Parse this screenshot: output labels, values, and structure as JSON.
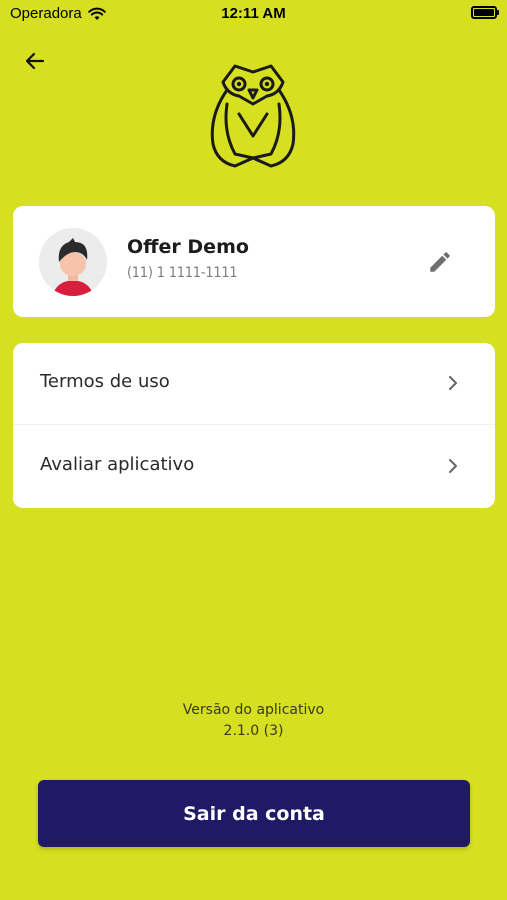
{
  "status_bar": {
    "carrier": "Operadora",
    "time": "12:11 AM",
    "wifi_icon": "wifi-icon",
    "battery_icon": "battery-icon"
  },
  "header": {
    "back_icon": "arrow-left-icon",
    "logo_icon": "owl-logo-icon"
  },
  "profile": {
    "name": "Offer Demo",
    "phone": "(11) 1 1111-1111",
    "avatar_icon": "user-avatar-icon",
    "edit_icon": "pencil-icon"
  },
  "menu": {
    "items": [
      {
        "label": "Termos de uso",
        "icon": "chevron-right-icon"
      },
      {
        "label": "Avaliar aplicativo",
        "icon": "chevron-right-icon"
      }
    ]
  },
  "version": {
    "label": "Versão do aplicativo",
    "value": "2.1.0 (3)"
  },
  "logout": {
    "label": "Sair da conta"
  },
  "colors": {
    "background": "#d6df20",
    "button": "#1f1a66",
    "card": "#ffffff"
  }
}
